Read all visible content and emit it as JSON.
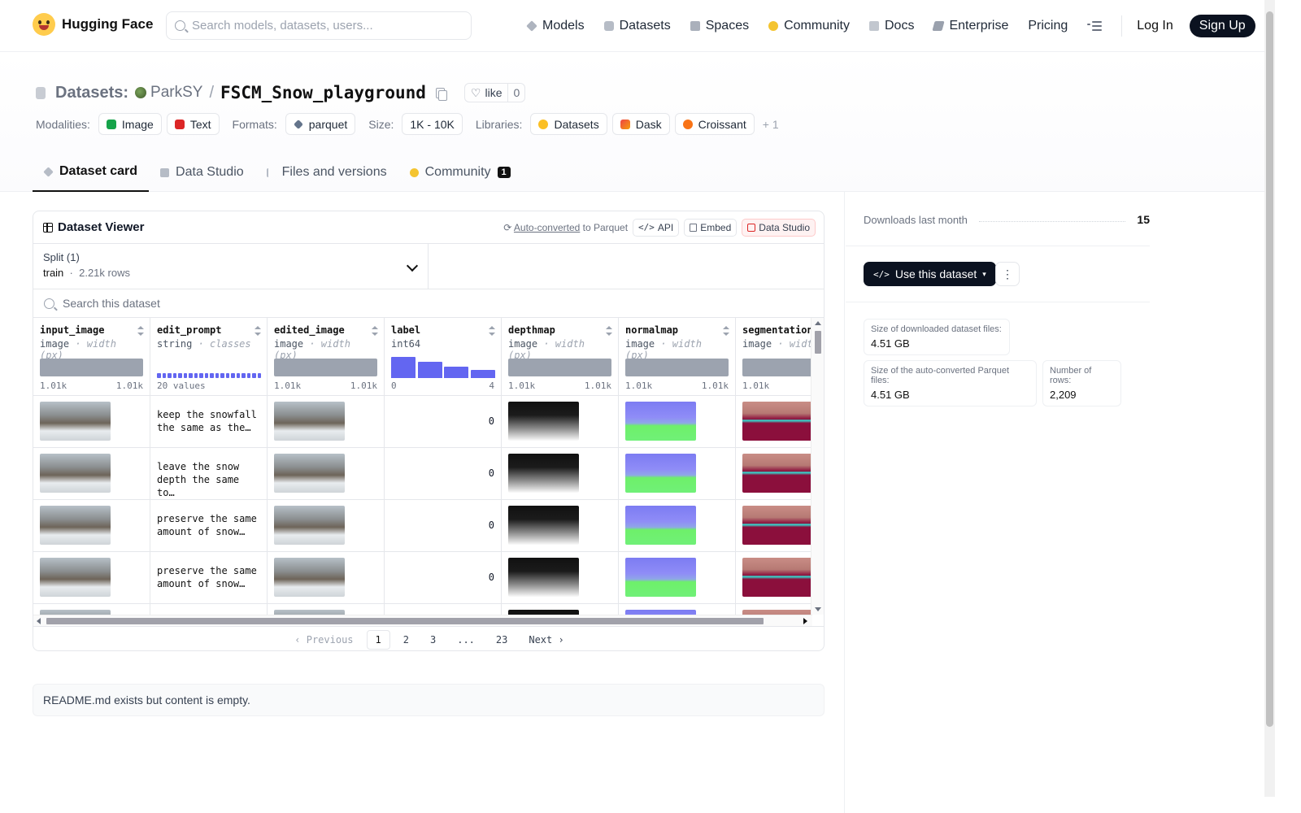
{
  "nav": {
    "brand": "Hugging Face",
    "search_placeholder": "Search models, datasets, users...",
    "links": [
      "Models",
      "Datasets",
      "Spaces",
      "Community",
      "Docs",
      "Enterprise",
      "Pricing"
    ],
    "login": "Log In",
    "signup": "Sign Up"
  },
  "header": {
    "crumb_label": "Datasets:",
    "owner": "ParkSY",
    "separator": "/",
    "dataset_name": "FSCM_Snow_playground",
    "like_label": "like",
    "like_count": "0",
    "modalities_label": "Modalities:",
    "modalities": [
      "Image",
      "Text"
    ],
    "formats_label": "Formats:",
    "format": "parquet",
    "size_label": "Size:",
    "size": "1K - 10K",
    "libraries_label": "Libraries:",
    "libraries": [
      "Datasets",
      "Dask",
      "Croissant"
    ],
    "libraries_more": "+ 1"
  },
  "tabs": [
    {
      "label": "Dataset card",
      "active": true
    },
    {
      "label": "Data Studio"
    },
    {
      "label": "Files and versions"
    },
    {
      "label": "Community",
      "badge": "1"
    }
  ],
  "viewer": {
    "title": "Dataset Viewer",
    "auto_converted": "Auto-converted",
    "to_parquet": "to Parquet",
    "api": "API",
    "embed": "Embed",
    "data_studio": "Data Studio",
    "split_label": "Split (1)",
    "split_name": "train",
    "split_dot": "·",
    "split_rows": "2.21k rows",
    "search_placeholder": "Search this dataset",
    "columns": [
      {
        "name": "input_image",
        "type": "image",
        "sub": "· width (px)",
        "min": "1.01k",
        "max": "1.01k"
      },
      {
        "name": "edit_prompt",
        "type": "string",
        "sub": "· classes",
        "summary": "20 values"
      },
      {
        "name": "edited_image",
        "type": "image",
        "sub": "· width (px)",
        "min": "1.01k",
        "max": "1.01k"
      },
      {
        "name": "label",
        "type": "int64",
        "sub": "",
        "min": "0",
        "max": "4"
      },
      {
        "name": "depthmap",
        "type": "image",
        "sub": "· width (px)",
        "min": "1.01k",
        "max": "1.01k"
      },
      {
        "name": "normalmap",
        "type": "image",
        "sub": "· width (px)",
        "min": "1.01k",
        "max": "1.01k"
      },
      {
        "name": "segmentationm",
        "type": "image",
        "sub": "· width",
        "min": "1.01k",
        "max": ""
      }
    ],
    "label_hist": [
      1.0,
      0.75,
      0.55,
      0.38
    ],
    "rows": [
      {
        "edit_prompt": "keep the snowfall the same as the…",
        "label": "0"
      },
      {
        "edit_prompt": "leave the snow depth the same to…",
        "label": "0"
      },
      {
        "edit_prompt": "preserve the same amount of snow…",
        "label": "0"
      },
      {
        "edit_prompt": "preserve the same amount of snow…",
        "label": "0"
      },
      {
        "edit_prompt": "",
        "label": ""
      }
    ],
    "pager": {
      "prev": "Previous",
      "pages": [
        "1",
        "2",
        "3",
        "...",
        "23"
      ],
      "next": "Next"
    }
  },
  "readme": "README.md exists but content is empty.",
  "sidebar": {
    "downloads_label": "Downloads last month",
    "downloads": "15",
    "use_button": "Use this dataset",
    "stats": [
      {
        "label": "Size of downloaded dataset files:",
        "value": "4.51 GB"
      },
      {
        "label": "Size of the auto-converted Parquet files:",
        "value": "4.51 GB"
      },
      {
        "label": "Number of rows:",
        "value": "2,209"
      }
    ]
  }
}
